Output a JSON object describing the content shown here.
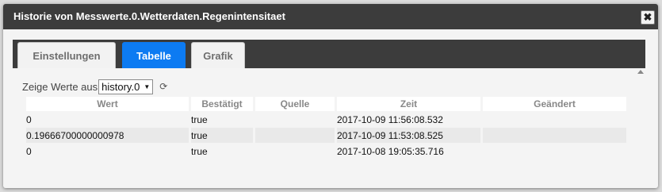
{
  "dialog": {
    "title": "Historie von Messwerte.0.Wetterdaten.Regenintensitaet",
    "close_symbol": "✖"
  },
  "tabs": [
    {
      "label": "Einstellungen",
      "active": false
    },
    {
      "label": "Tabelle",
      "active": true
    },
    {
      "label": "Grafik",
      "active": false
    }
  ],
  "toolbar": {
    "show_values_label": "Zeige Werte aus",
    "instance_select": "history.0",
    "refresh_icon": "refresh-icon"
  },
  "table": {
    "columns": [
      "Wert",
      "Bestätigt",
      "Quelle",
      "Zeit",
      "Geändert"
    ],
    "rows": [
      {
        "wert": "0",
        "bestaetigt": "true",
        "quelle": "",
        "zeit": "2017-10-09 11:56:08.532",
        "geaendert": ""
      },
      {
        "wert": "0.19666700000000978",
        "bestaetigt": "true",
        "quelle": "",
        "zeit": "2017-10-09 11:53:08.525",
        "geaendert": ""
      },
      {
        "wert": "0",
        "bestaetigt": "true",
        "quelle": "",
        "zeit": "2017-10-08 19:05:35.716",
        "geaendert": ""
      }
    ]
  },
  "colors": {
    "titlebar_bg": "#3c3c3c",
    "active_tab": "#0d7bf2"
  }
}
